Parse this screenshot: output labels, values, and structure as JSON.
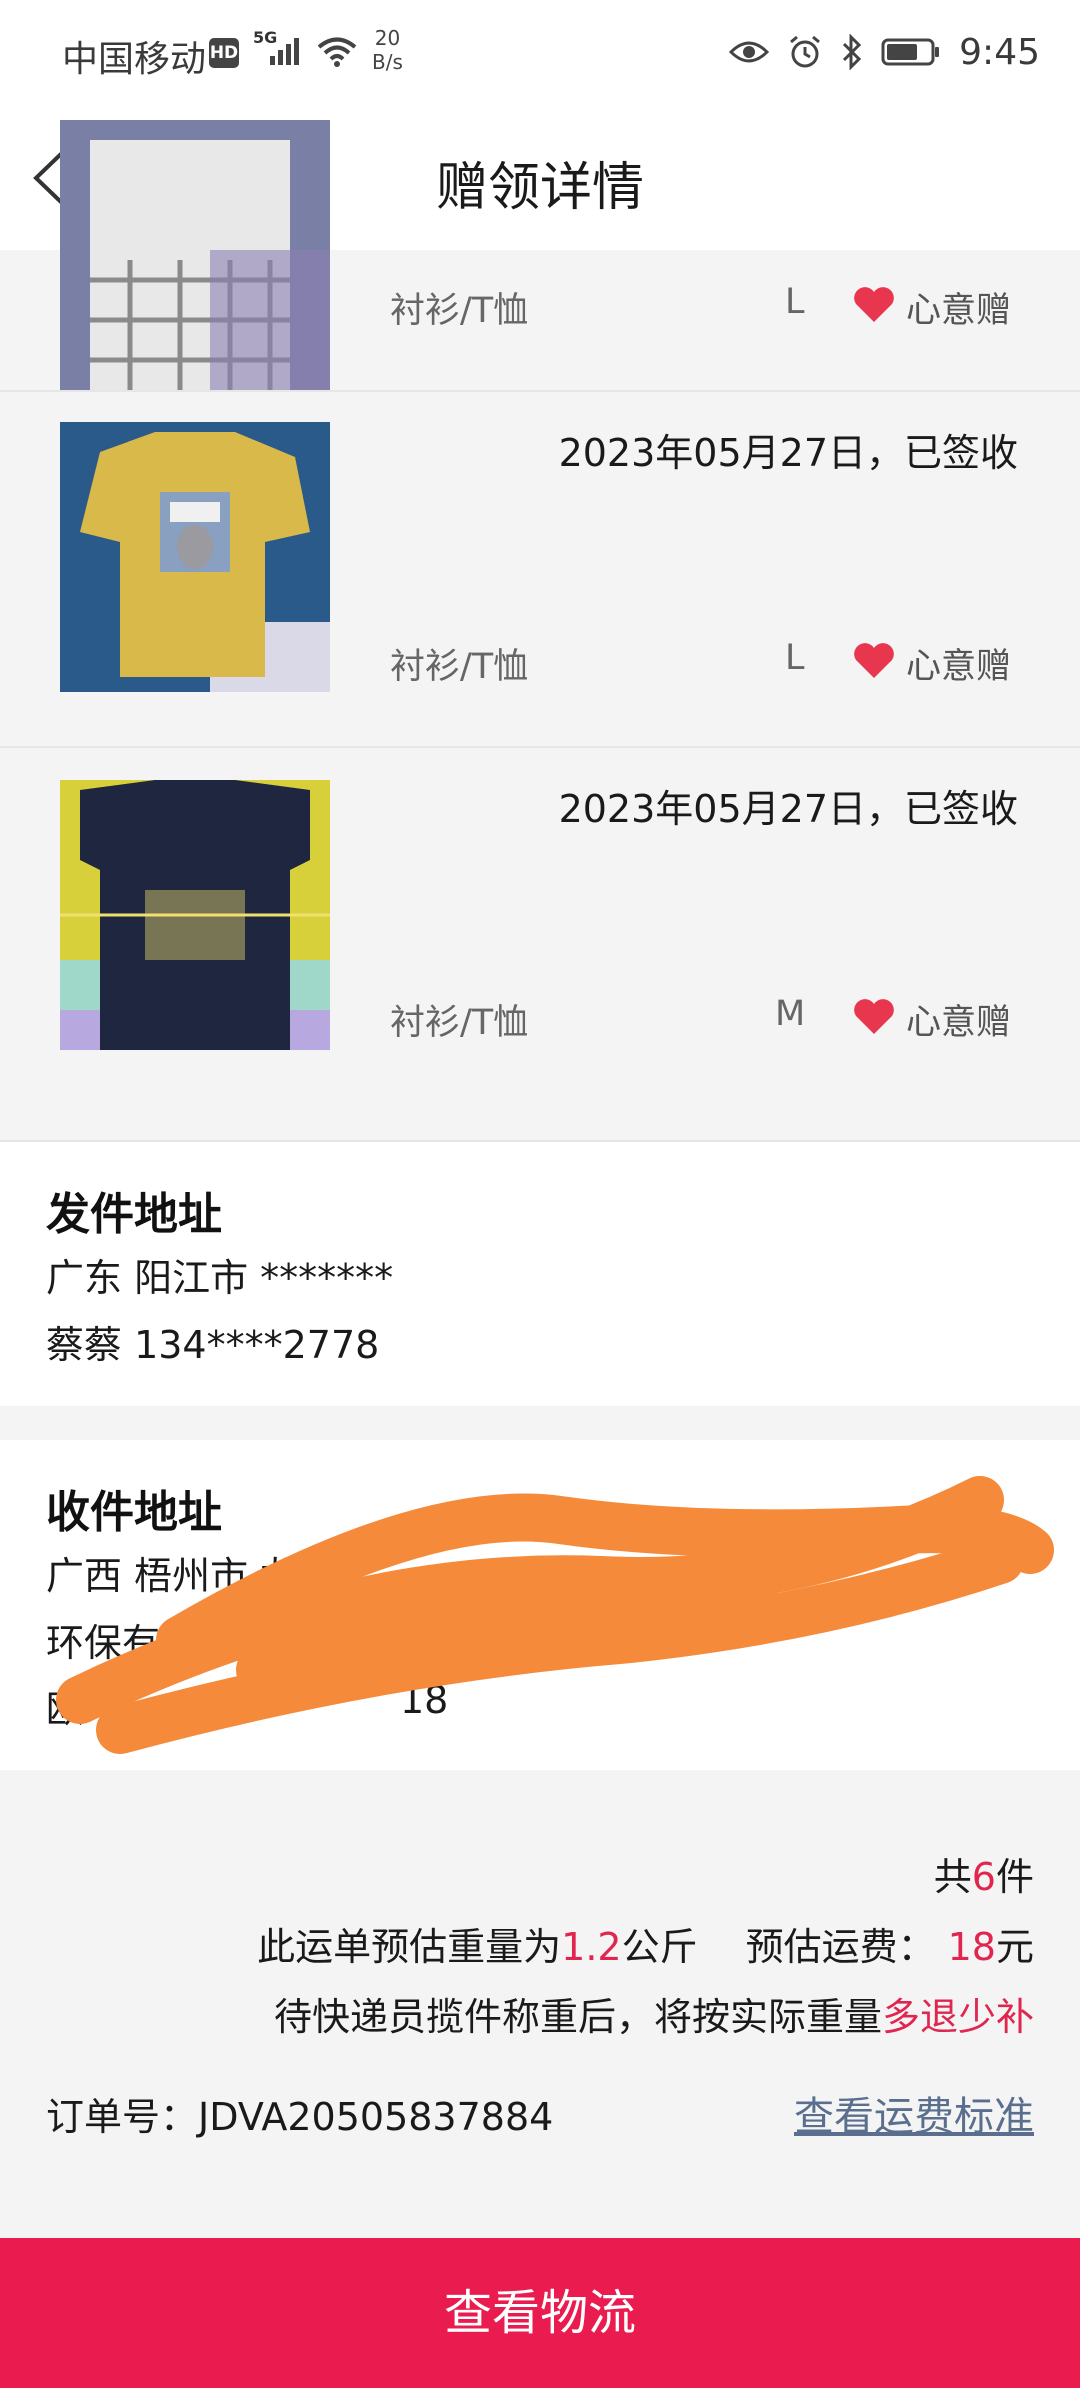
{
  "status_bar": {
    "carrier": "中国移动",
    "hd": "HD",
    "network": "5G",
    "net_speed_value": "20",
    "net_speed_unit": "B/s",
    "time": "9:45"
  },
  "header": {
    "title": "赠领详情",
    "back_icon": "chevron-left-icon"
  },
  "items": [
    {
      "date": "",
      "category": "衬衫/T恤",
      "size": "L",
      "gift_type": "心意赠"
    },
    {
      "date": "2023年05月27日，已签收",
      "category": "衬衫/T恤",
      "size": "L",
      "gift_type": "心意赠"
    },
    {
      "date": "2023年05月27日，已签收",
      "category": "衬衫/T恤",
      "size": "M",
      "gift_type": "心意赠"
    }
  ],
  "sender": {
    "title": "发件地址",
    "address": "广东 阳江市 *******",
    "contact": "蔡蔡 134****2778"
  },
  "receiver": {
    "title": "收件地址",
    "address_line1": "广西 梧州市 龙圩区",
    "address_line2": "环保有限",
    "contact_prefix": "欧",
    "contact_suffix": "18"
  },
  "summary": {
    "total_prefix": "共",
    "total_count": "6",
    "total_suffix": "件",
    "weight_prefix": "此运单预估重量为",
    "weight_value": "1.2",
    "weight_unit": "公斤",
    "fee_label": "预估运费：",
    "fee_value": "18",
    "fee_unit": "元",
    "note_prefix": "待快递员揽件称重后，将按实际重量",
    "note_highlight": "多退少补",
    "order_label": "订单号：",
    "order_no": "JDVA20505837884",
    "fee_standard_link": "查看运费标准"
  },
  "bottom_button": {
    "label": "查看物流"
  },
  "colors": {
    "accent": "#ea1c4f",
    "highlight": "#e0264f",
    "link": "#5a6e8e",
    "heart": "#e8364e"
  }
}
